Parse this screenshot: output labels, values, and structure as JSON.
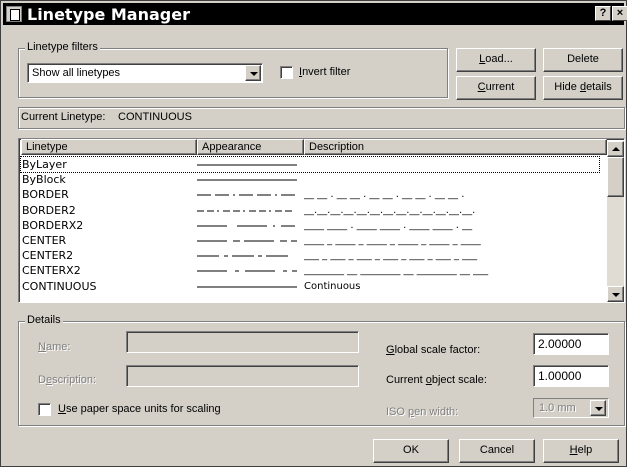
{
  "window": {
    "title": "Linetype Manager",
    "help_btn": "?",
    "close_btn": "×"
  },
  "filters": {
    "group_label": "Linetype filters",
    "combo_value": "Show all linetypes",
    "invert_label": "Invert filter",
    "invert_checked": false
  },
  "buttons": {
    "load": "Load...",
    "delete": "Delete",
    "current": "Current",
    "hide_details": "Hide details",
    "ok": "OK",
    "cancel": "Cancel",
    "help": "Help"
  },
  "current_linetype_label": "Current Linetype:",
  "current_linetype_value": "CONTINUOUS",
  "table": {
    "columns": [
      "Linetype",
      "Appearance",
      "Description"
    ],
    "rows": [
      {
        "name": "ByLayer",
        "appearance": "solid",
        "description": ""
      },
      {
        "name": "ByBlock",
        "appearance": "solid",
        "description": ""
      },
      {
        "name": "BORDER",
        "appearance": "border",
        "description": "__ __ . __ __ . __ __ . __ __ . __ __ ."
      },
      {
        "name": "BORDER2",
        "appearance": "border2",
        "description": "__.__.__.__.__.__.__.__.__.__.__.__.__."
      },
      {
        "name": "BORDERX2",
        "appearance": "borderx2",
        "description": "____ ____ . ____ ____ . ____ ____ . __"
      },
      {
        "name": "CENTER",
        "appearance": "center",
        "description": "____ _ ____ _ ____ _ ____ _ ____ _ ____"
      },
      {
        "name": "CENTER2",
        "appearance": "center2",
        "description": "___ _ ___ _ ___ _ ___ _ ___ _ ___ _ ___"
      },
      {
        "name": "CENTERX2",
        "appearance": "centerx2",
        "description": "________ __ ________ __ ________ __ ___"
      },
      {
        "name": "CONTINUOUS",
        "appearance": "solid",
        "description": "Continuous"
      }
    ],
    "selected_row": 0
  },
  "details": {
    "group_label": "Details",
    "name_label": "Name:",
    "name_value": "",
    "description_label": "Description:",
    "description_value": "",
    "paper_space_label": "Use paper space units for scaling",
    "paper_space_checked": false,
    "global_scale_label": "Global scale factor:",
    "global_scale_value": "2.00000",
    "object_scale_label": "Current object scale:",
    "object_scale_value": "1.00000",
    "iso_pen_label": "ISO pen width:",
    "iso_pen_value": "1.0 mm"
  }
}
